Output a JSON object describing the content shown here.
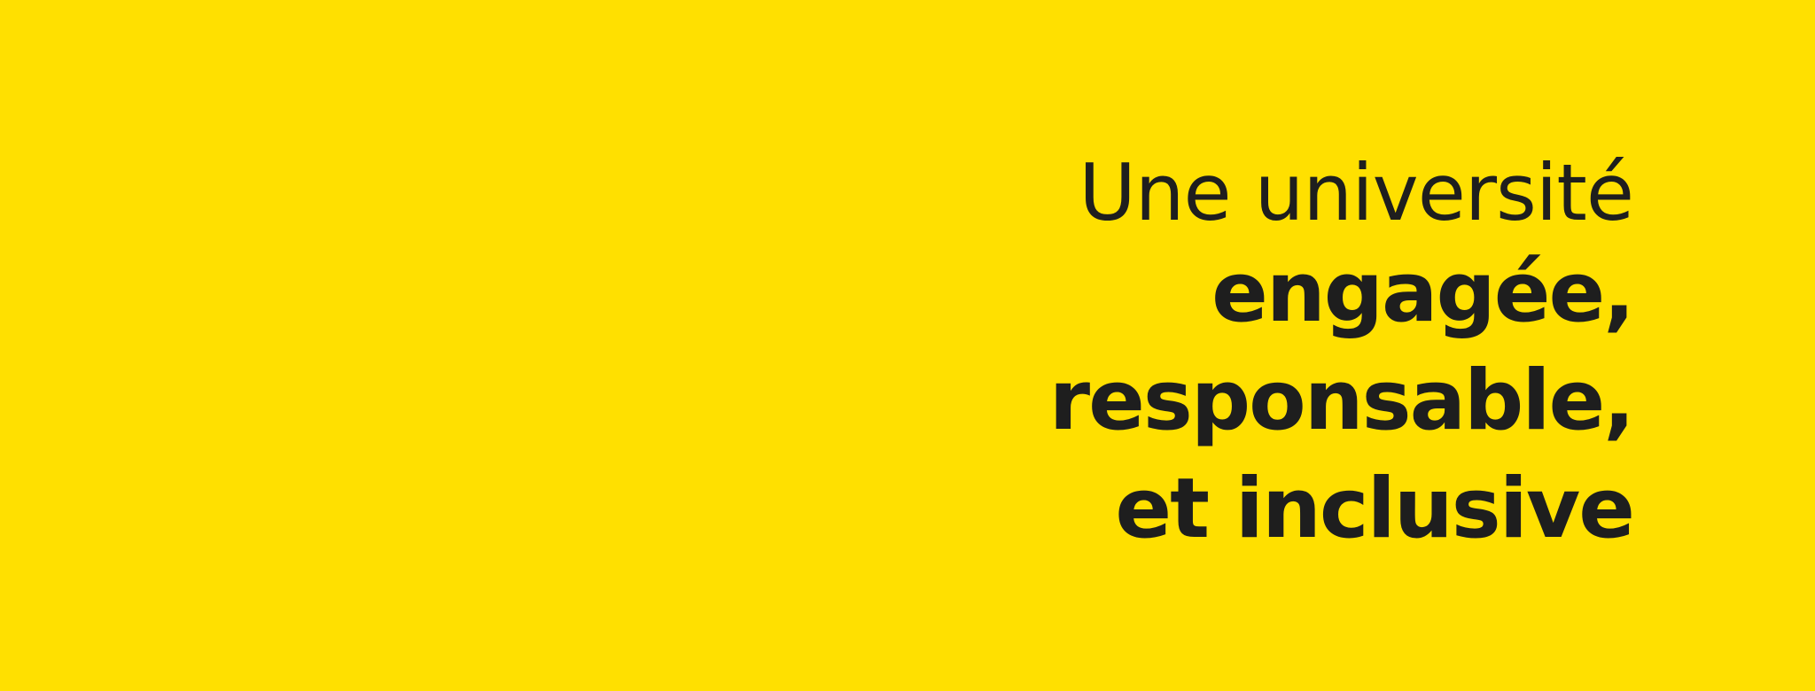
{
  "brand": {
    "background_color": "#FFE000",
    "text_color": "#1e1e1e"
  },
  "headline": {
    "line1": "Une université",
    "line2": "engagée,",
    "line3": "responsable,",
    "line4": "et inclusive"
  }
}
